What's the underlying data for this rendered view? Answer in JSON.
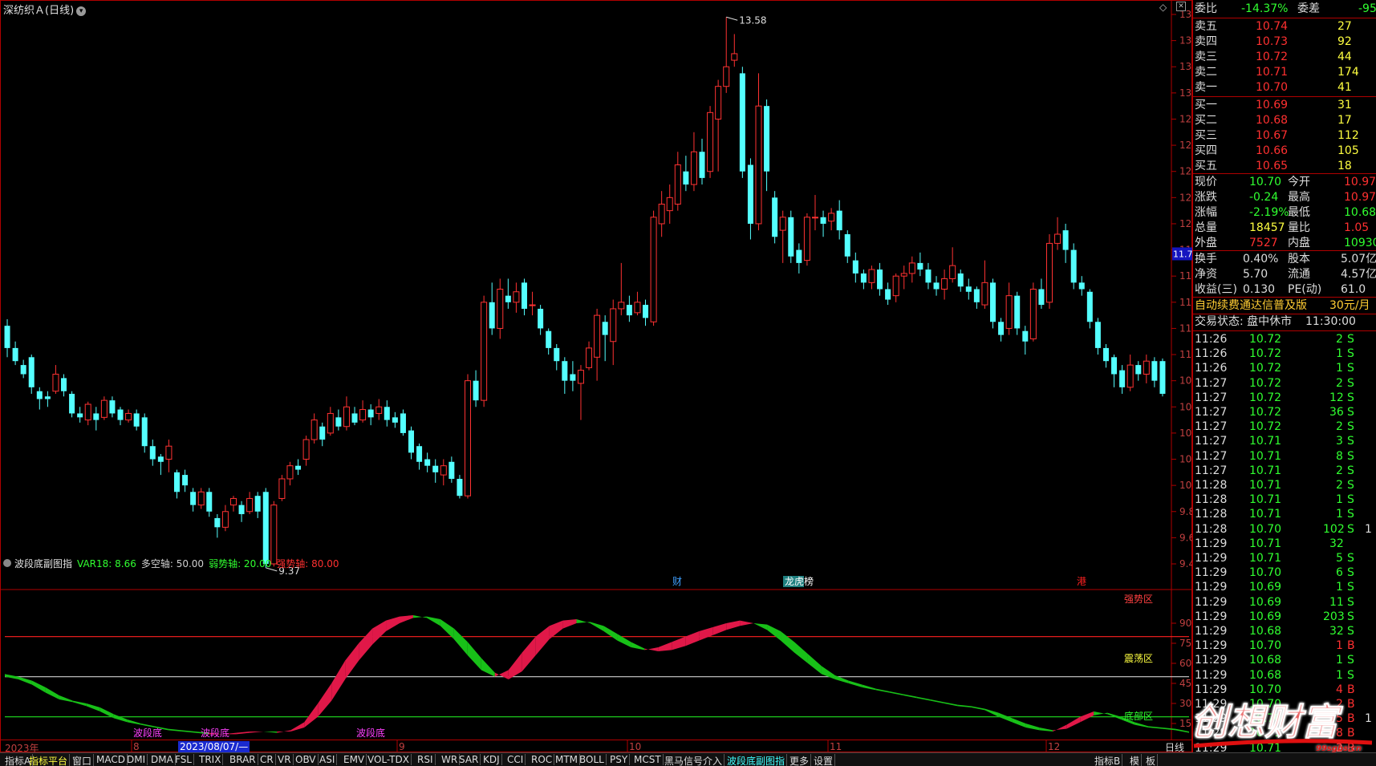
{
  "window": {
    "title": "深纺织Ａ(日线)",
    "restore_icon": "diamond-icon",
    "close_icon": "close-box-icon"
  },
  "price_axis": {
    "labels": [
      "13.60",
      "13.40",
      "13.20",
      "13.00",
      "12.80",
      "12.60",
      "12.40",
      "12.20",
      "12.00",
      "11.80",
      "11.60",
      "11.40",
      "11.20",
      "11.00",
      "10.80",
      "10.60",
      "10.40",
      "10.20",
      "10.00",
      "9.80",
      "9.60",
      "9.40"
    ],
    "current_label": "11.77",
    "high_marker": "13.58",
    "low_marker": "9.37"
  },
  "event_markers": [
    {
      "label": "财",
      "color": "#3fa0ff"
    },
    {
      "label": "龙虎榜",
      "color": "#ffffff",
      "bg": "#1e7f7f"
    },
    {
      "label": "港",
      "color": "#ff2020"
    }
  ],
  "candles_colors": {
    "up": "#ff3232",
    "down": "#54ffff"
  },
  "indicator": {
    "name": "波段底副图指",
    "var18_label": "VAR18: 8.66",
    "multi_axis_label": "多空轴: 50.00",
    "weak_axis_label": "弱势轴: 20.00",
    "strong_axis_label": "强势轴: 80.00",
    "axis_labels": [
      "90.00",
      "75.00",
      "60.00",
      "45.00",
      "30.00",
      "15.00"
    ],
    "zones": {
      "strong": "强势区",
      "oscillation": "震荡区",
      "weak": "底部区"
    },
    "bottom_tag": "波段底",
    "level_colors": {
      "strong": "#ff2020",
      "mid": "#d0d0d0",
      "weak": "#20e020"
    },
    "fill_colors": {
      "up": "#e01848",
      "down": "#18c018"
    }
  },
  "date_axis": {
    "labels": [
      "2023年",
      "8",
      "2023/08/07/—",
      "9",
      "10",
      "11",
      "12",
      "1"
    ]
  },
  "right_panel": {
    "weibi": {
      "label": "委比",
      "value": "-14.37%",
      "label2": "委差",
      "value2": "-95"
    },
    "asks": [
      {
        "label": "卖五",
        "price": "10.74",
        "vol": "27"
      },
      {
        "label": "卖四",
        "price": "10.73",
        "vol": "92"
      },
      {
        "label": "卖三",
        "price": "10.72",
        "vol": "44"
      },
      {
        "label": "卖二",
        "price": "10.71",
        "vol": "174"
      },
      {
        "label": "卖一",
        "price": "10.70",
        "vol": "41"
      }
    ],
    "bids": [
      {
        "label": "买一",
        "price": "10.69",
        "vol": "31"
      },
      {
        "label": "买二",
        "price": "10.68",
        "vol": "17"
      },
      {
        "label": "买三",
        "price": "10.67",
        "vol": "112"
      },
      {
        "label": "买四",
        "price": "10.66",
        "vol": "105"
      },
      {
        "label": "买五",
        "price": "10.65",
        "vol": "18"
      }
    ],
    "quote": [
      {
        "l1": "现价",
        "v1": "10.70",
        "c1": "#30ff30",
        "l2": "今开",
        "v2": "10.97",
        "c2": "#ff3030"
      },
      {
        "l1": "涨跌",
        "v1": "-0.24",
        "c1": "#30ff30",
        "l2": "最高",
        "v2": "10.97",
        "c2": "#ff3030"
      },
      {
        "l1": "涨幅",
        "v1": "-2.19%",
        "c1": "#30ff30",
        "l2": "最低",
        "v2": "10.68",
        "c2": "#30ff30"
      },
      {
        "l1": "总量",
        "v1": "18457",
        "c1": "#ffff40",
        "l2": "量比",
        "v2": "1.05",
        "c2": "#ff3030"
      },
      {
        "l1": "外盘",
        "v1": "7527",
        "c1": "#ff3030",
        "l2": "内盘",
        "v2": "10930",
        "c2": "#30ff30"
      }
    ],
    "fundamentals": [
      {
        "l1": "换手",
        "v1": "0.40%",
        "l2": "股本",
        "v2": "5.07亿"
      },
      {
        "l1": "净资",
        "v1": "5.70",
        "l2": "流通",
        "v2": "4.57亿"
      },
      {
        "l1": "收益(三)",
        "v1": "0.130",
        "l2": "PE(动)",
        "v2": "61.0"
      }
    ],
    "promo": {
      "text": "自动续费通达信普及版",
      "price": "30元/月"
    },
    "trade_status": {
      "label": "交易状态: 盘中休市",
      "time": "11:30:00"
    },
    "ticks": [
      {
        "t": "11:26",
        "p": "10.72",
        "v": "2",
        "s": "S",
        "x": ""
      },
      {
        "t": "11:26",
        "p": "10.72",
        "v": "1",
        "s": "S",
        "x": ""
      },
      {
        "t": "11:26",
        "p": "10.72",
        "v": "1",
        "s": "S",
        "x": ""
      },
      {
        "t": "11:27",
        "p": "10.72",
        "v": "2",
        "s": "S",
        "x": ""
      },
      {
        "t": "11:27",
        "p": "10.72",
        "v": "12",
        "s": "S",
        "x": ""
      },
      {
        "t": "11:27",
        "p": "10.72",
        "v": "36",
        "s": "S",
        "x": ""
      },
      {
        "t": "11:27",
        "p": "10.72",
        "v": "2",
        "s": "S",
        "x": ""
      },
      {
        "t": "11:27",
        "p": "10.71",
        "v": "3",
        "s": "S",
        "x": ""
      },
      {
        "t": "11:27",
        "p": "10.71",
        "v": "8",
        "s": "S",
        "x": ""
      },
      {
        "t": "11:27",
        "p": "10.71",
        "v": "2",
        "s": "S",
        "x": ""
      },
      {
        "t": "11:28",
        "p": "10.71",
        "v": "2",
        "s": "S",
        "x": ""
      },
      {
        "t": "11:28",
        "p": "10.71",
        "v": "1",
        "s": "S",
        "x": ""
      },
      {
        "t": "11:28",
        "p": "10.71",
        "v": "1",
        "s": "S",
        "x": ""
      },
      {
        "t": "11:28",
        "p": "10.70",
        "v": "102",
        "s": "S",
        "x": "1"
      },
      {
        "t": "11:29",
        "p": "10.71",
        "v": "32",
        "s": "",
        "x": ""
      },
      {
        "t": "11:29",
        "p": "10.71",
        "v": "5",
        "s": "S",
        "x": ""
      },
      {
        "t": "11:29",
        "p": "10.70",
        "v": "6",
        "s": "S",
        "x": ""
      },
      {
        "t": "11:29",
        "p": "10.69",
        "v": "1",
        "s": "S",
        "x": ""
      },
      {
        "t": "11:29",
        "p": "10.69",
        "v": "11",
        "s": "S",
        "x": ""
      },
      {
        "t": "11:29",
        "p": "10.69",
        "v": "203",
        "s": "S",
        "x": ""
      },
      {
        "t": "11:29",
        "p": "10.68",
        "v": "32",
        "s": "S",
        "x": ""
      },
      {
        "t": "11:29",
        "p": "10.70",
        "v": "1",
        "s": "B",
        "x": ""
      },
      {
        "t": "11:29",
        "p": "10.68",
        "v": "1",
        "s": "S",
        "x": ""
      },
      {
        "t": "11:29",
        "p": "10.68",
        "v": "1",
        "s": "S",
        "x": ""
      },
      {
        "t": "11:29",
        "p": "10.70",
        "v": "4",
        "s": "B",
        "x": ""
      },
      {
        "t": "11:29",
        "p": "10.70",
        "v": "2",
        "s": "B",
        "x": ""
      },
      {
        "t": "11:29",
        "p": "10.70",
        "v": "5",
        "s": "B",
        "x": "1"
      },
      {
        "t": "11:29",
        "p": "10.71",
        "v": "8",
        "s": "B",
        "x": ""
      },
      {
        "t": "11:29",
        "p": "10.71",
        "v": "2",
        "s": "B",
        "x": ""
      }
    ]
  },
  "tabs": {
    "items": [
      "指标A",
      "指标平台",
      "窗口",
      "MACD",
      "DMI",
      "DMA",
      "FSL",
      "TRIX",
      "BRAR",
      "CR",
      "VR",
      "OBV",
      "ASI",
      "EMV",
      "VOL-TDX",
      "RSI",
      "WR",
      "SAR",
      "KDJ",
      "CCI",
      "ROC",
      "MTM",
      "BOLL",
      "PSY",
      "MCST",
      "黑马信号介入",
      "波段底副图指",
      "更多",
      "设置"
    ],
    "right": [
      "指标B",
      "模",
      "板"
    ],
    "period": "日线"
  },
  "watermark": {
    "text": "创想财富",
    "url": "99sgbs.cn"
  }
}
